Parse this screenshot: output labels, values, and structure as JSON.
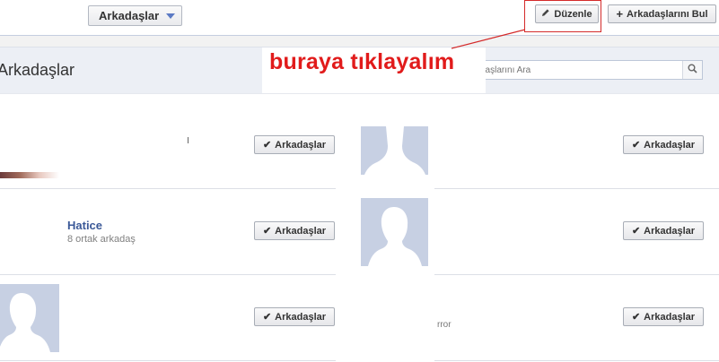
{
  "topbar": {
    "friends_dropdown_label": "Arkadaşlar",
    "edit_button_label": "Düzenle",
    "find_friends_button_label": "Arkadaşlarını Bul",
    "plus_glyph": "+"
  },
  "header": {
    "title": "Arkadaşlar",
    "search_placeholder": "daşlarını Ara"
  },
  "callout": {
    "text": "buraya tıklayalım",
    "color": "#e11b1b"
  },
  "friends": [
    {
      "name": "",
      "mutual": "",
      "button": "Arkadaşlar"
    },
    {
      "name": "",
      "mutual": "",
      "button": "Arkadaşlar"
    },
    {
      "name": "Hatice",
      "mutual": "8 ortak arkadaş",
      "button": "Arkadaşlar"
    },
    {
      "name": "",
      "mutual": "",
      "button": "Arkadaşlar"
    },
    {
      "name": "",
      "mutual": "",
      "button": "Arkadaşlar"
    },
    {
      "name": "",
      "mutual": "",
      "button": "Arkadaşlar"
    }
  ],
  "fragments": {
    "row3_right_text": "rror"
  },
  "colors": {
    "link_blue": "#3b5998",
    "avatar_bg": "#c7d0e3",
    "avatar_silhouette": "#ffffff",
    "highlight_border": "#d42a2a"
  }
}
